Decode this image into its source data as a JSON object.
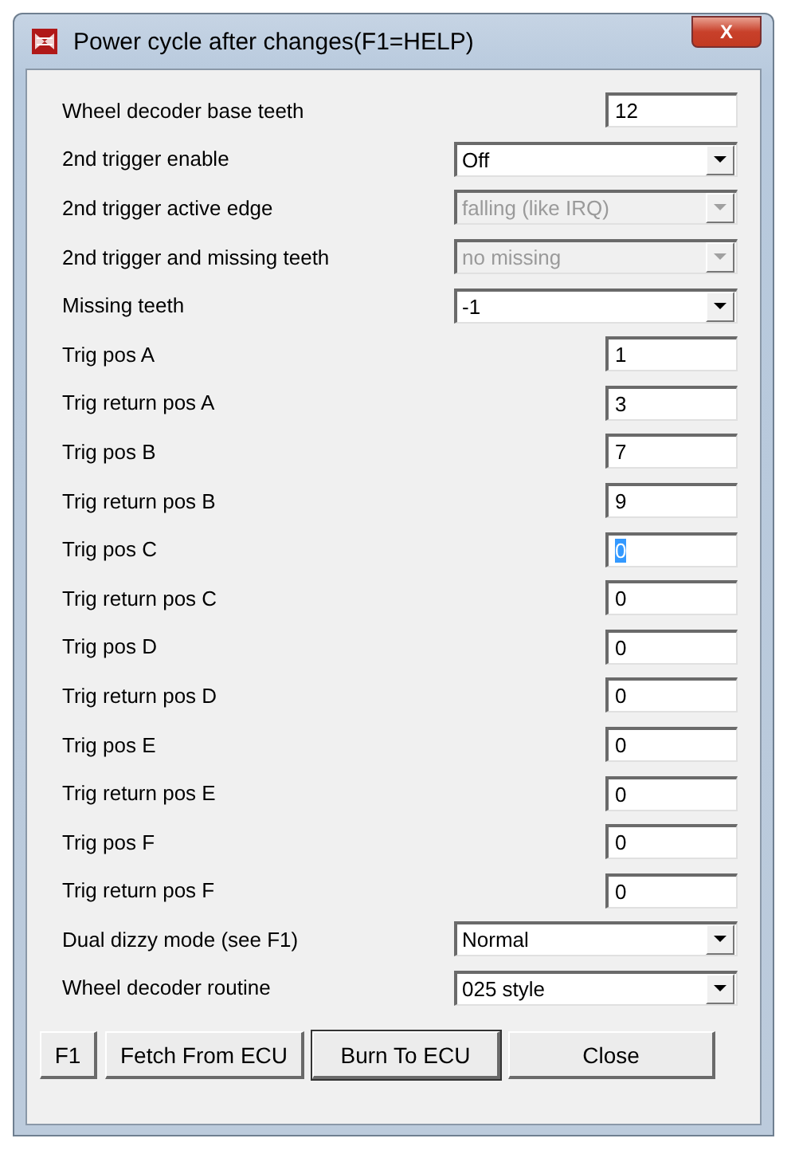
{
  "window": {
    "title": "Power cycle after changes(F1=HELP)",
    "close_label": "X"
  },
  "fields": [
    {
      "kind": "text",
      "label": "Wheel decoder base teeth",
      "value": "12",
      "focused": false,
      "disabled": false
    },
    {
      "kind": "select",
      "label": "2nd trigger enable",
      "value": "Off",
      "focused": false,
      "disabled": false
    },
    {
      "kind": "select",
      "label": "2nd trigger active edge",
      "value": "falling (like IRQ)",
      "focused": false,
      "disabled": true
    },
    {
      "kind": "select",
      "label": "2nd trigger and missing teeth",
      "value": "no missing",
      "focused": false,
      "disabled": true
    },
    {
      "kind": "select",
      "label": "Missing teeth",
      "value": "-1",
      "focused": false,
      "disabled": false
    },
    {
      "kind": "text",
      "label": "Trig pos A",
      "value": "1",
      "focused": false,
      "disabled": false
    },
    {
      "kind": "text",
      "label": "Trig return pos A",
      "value": "3",
      "focused": false,
      "disabled": false
    },
    {
      "kind": "text",
      "label": "Trig pos B",
      "value": "7",
      "focused": false,
      "disabled": false
    },
    {
      "kind": "text",
      "label": "Trig return pos B",
      "value": "9",
      "focused": false,
      "disabled": false
    },
    {
      "kind": "text",
      "label": "Trig pos C",
      "value": "0",
      "focused": true,
      "disabled": false
    },
    {
      "kind": "text",
      "label": "Trig return pos C",
      "value": "0",
      "focused": false,
      "disabled": false
    },
    {
      "kind": "text",
      "label": "Trig pos D",
      "value": "0",
      "focused": false,
      "disabled": false
    },
    {
      "kind": "text",
      "label": "Trig return pos D",
      "value": "0",
      "focused": false,
      "disabled": false
    },
    {
      "kind": "text",
      "label": "Trig pos E",
      "value": "0",
      "focused": false,
      "disabled": false
    },
    {
      "kind": "text",
      "label": "Trig return pos E",
      "value": "0",
      "focused": false,
      "disabled": false
    },
    {
      "kind": "text",
      "label": "Trig pos F",
      "value": "0",
      "focused": false,
      "disabled": false
    },
    {
      "kind": "text",
      "label": "Trig return pos F",
      "value": "0",
      "focused": false,
      "disabled": false
    },
    {
      "kind": "select",
      "label": "Dual dizzy mode (see F1)",
      "value": "Normal",
      "focused": false,
      "disabled": false
    },
    {
      "kind": "select",
      "label": "Wheel decoder routine",
      "value": "025 style",
      "focused": false,
      "disabled": false
    }
  ],
  "buttons": [
    {
      "label": "F1",
      "default": false
    },
    {
      "label": "Fetch From ECU",
      "default": false
    },
    {
      "label": "Burn To ECU",
      "default": true
    },
    {
      "label": "Close",
      "default": false
    }
  ]
}
